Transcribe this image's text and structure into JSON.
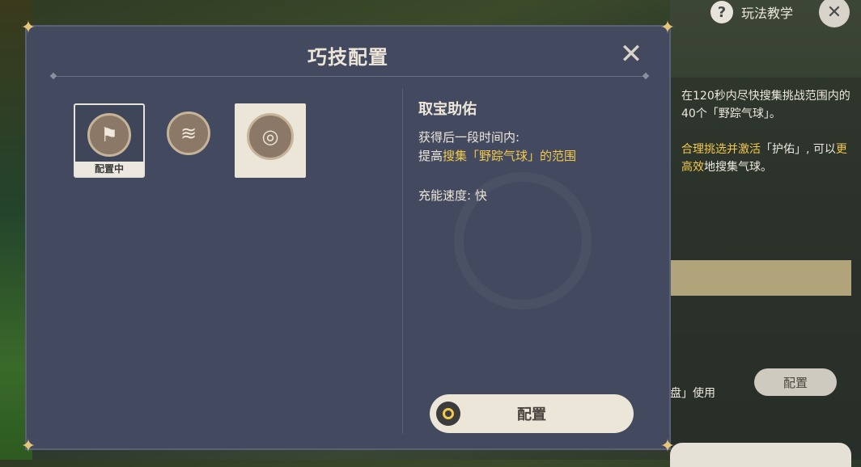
{
  "topbar": {
    "help_label": "玩法教学"
  },
  "dialog": {
    "title": "巧技配置",
    "slots": [
      {
        "name": "gadget-slot-1",
        "status": "配置中"
      },
      {
        "name": "gadget-slot-2"
      },
      {
        "name": "gadget-slot-3"
      }
    ],
    "detail": {
      "name": "取宝助佑",
      "line1": "获得后一段时间内:",
      "line2_prefix": "提高",
      "line2_highlight": "搜集「野踪气球」的范围",
      "speed": "充能速度: 快"
    },
    "config_button": "配置"
  },
  "right_panel": {
    "desc1": "在120秒内尽快搜集挑战范围内的40个「野踪气球」。",
    "desc2_hl1": "合理挑选并激活",
    "desc2_mid": "「护佑」, 可以",
    "desc2_hl2": "更高效",
    "desc2_end": "地搜集气球。",
    "use_text": "盘」使用",
    "config_button": "配置"
  },
  "colors": {
    "accent": "#f2c94c",
    "panel": "#434a5f"
  }
}
